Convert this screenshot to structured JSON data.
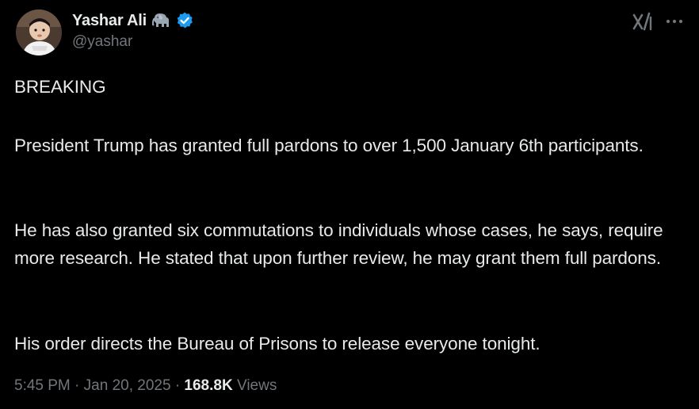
{
  "author": {
    "display_name": "Yashar Ali",
    "handle": "@yashar",
    "badge_emoji": "elephant",
    "verified": true,
    "verified_color": "#1d9bf0"
  },
  "actions": {
    "grok_icon": "grok-icon",
    "more_icon": "more-icon"
  },
  "tweet": {
    "line1": "BREAKING",
    "para2": "President Trump has granted full pardons to over 1,500 January 6th participants.",
    "para3": "He has also granted six commutations to individuals whose cases, he says, require more research. He stated that upon further review, he may grant them full pardons.",
    "para4": "His order directs the Bureau of Prisons to release everyone tonight."
  },
  "meta": {
    "time": "5:45 PM",
    "separator": "·",
    "date": "Jan 20, 2025",
    "views_count": "168.8K",
    "views_label": "Views"
  },
  "colors": {
    "background": "#000000",
    "text_primary": "#e7e9ea",
    "text_secondary": "#71767b",
    "accent": "#1d9bf0"
  }
}
